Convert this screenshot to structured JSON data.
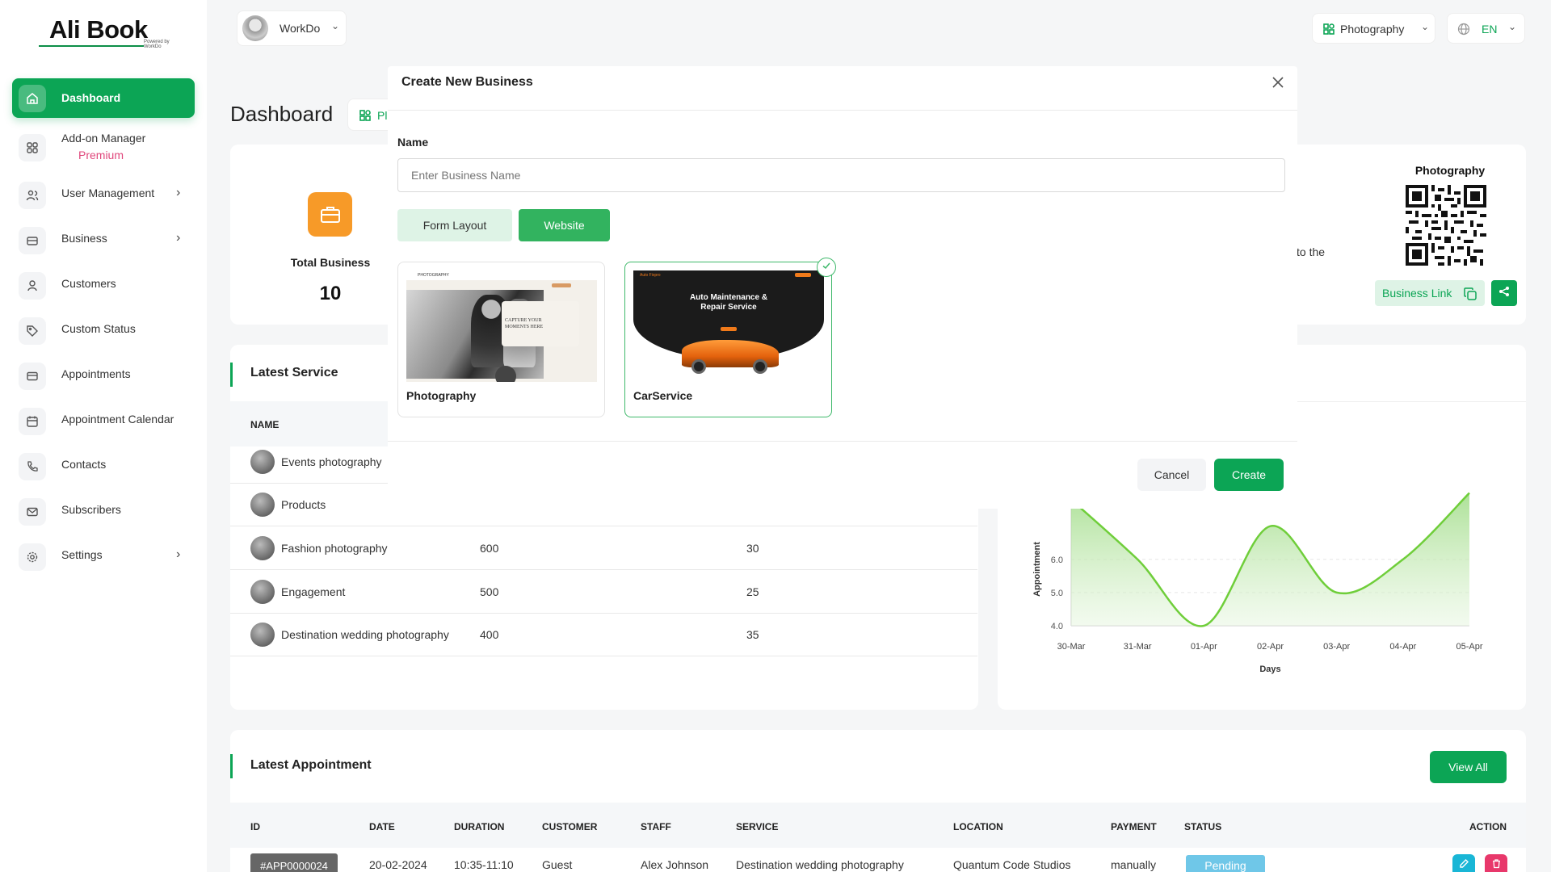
{
  "app": {
    "logo": "Ali Book",
    "logo_sub": "Powered by WorkDo"
  },
  "header": {
    "workspace": "WorkDo",
    "business_selector": "Photography",
    "language": "EN"
  },
  "sidebar": {
    "items": [
      {
        "label": "Dashboard",
        "sub": ""
      },
      {
        "label": "Add-on Manager",
        "sub": "Premium"
      },
      {
        "label": "User Management",
        "sub": ""
      },
      {
        "label": "Business",
        "sub": ""
      },
      {
        "label": "Customers",
        "sub": ""
      },
      {
        "label": "Custom Status",
        "sub": ""
      },
      {
        "label": "Appointments",
        "sub": ""
      },
      {
        "label": "Appointment Calendar",
        "sub": ""
      },
      {
        "label": "Contacts",
        "sub": ""
      },
      {
        "label": "Subscribers",
        "sub": ""
      },
      {
        "label": "Settings",
        "sub": ""
      }
    ]
  },
  "page": {
    "title": "Dashboard",
    "title_chip": "Pl"
  },
  "stats": {
    "total_business_label": "Total Business",
    "total_business_value": "10"
  },
  "business_card": {
    "title": "Photography",
    "partial_text": "to the",
    "link_label": "Business Link"
  },
  "latest_service": {
    "title": "Latest Service",
    "col_name": "NAME",
    "rows": [
      {
        "name": "Events photography",
        "price": "",
        "duration": ""
      },
      {
        "name": "Products",
        "price": "",
        "duration": ""
      },
      {
        "name": "Fashion photography",
        "price": "600",
        "duration": "30"
      },
      {
        "name": "Engagement",
        "price": "500",
        "duration": "25"
      },
      {
        "name": "Destination wedding photography",
        "price": "400",
        "duration": "35"
      }
    ]
  },
  "chart_data": {
    "type": "area",
    "x": [
      "30-Mar",
      "31-Mar",
      "01-Apr",
      "02-Apr",
      "03-Apr",
      "04-Apr",
      "05-Apr"
    ],
    "values": [
      7.8,
      6.0,
      4.0,
      7.0,
      5.0,
      6.0,
      8.0
    ],
    "xlabel": "Days",
    "ylabel": "Appointment",
    "yticks": [
      "4.0",
      "5.0",
      "6.0"
    ],
    "color": "#6fce3a"
  },
  "latest_appointment": {
    "title": "Latest Appointment",
    "view_all": "View All",
    "columns": [
      "ID",
      "DATE",
      "DURATION",
      "CUSTOMER",
      "STAFF",
      "SERVICE",
      "LOCATION",
      "PAYMENT",
      "STATUS",
      "ACTION"
    ],
    "rows": [
      {
        "id": "#APP0000024",
        "date": "20-02-2024",
        "duration": "10:35-11:10",
        "customer": "Guest",
        "staff": "Alex Johnson",
        "service": "Destination wedding photography",
        "location": "Quantum Code Studios",
        "payment": "manually",
        "status": "Pending"
      }
    ]
  },
  "modal": {
    "title": "Create New Business",
    "name_label": "Name",
    "name_placeholder": "Enter Business Name",
    "name_value": "",
    "tab_form": "Form Layout",
    "tab_website": "Website",
    "templates": [
      {
        "name": "Photography",
        "preview_brand": "PHOTOGRAPHY",
        "preview_headline": "CAPTURE YOUR MOMENTS HERE",
        "selected": false
      },
      {
        "name": "CarService",
        "preview_brand": "Auto Fixpro",
        "preview_headline": "Auto Maintenance & Repair Service",
        "selected": true
      }
    ],
    "cancel": "Cancel",
    "create": "Create"
  },
  "colors": {
    "primary": "#0ca555",
    "light_green": "#def3e6",
    "orange": "#f79a28",
    "pending": "#6fc7e8",
    "danger": "#e8386b",
    "accent_pink": "#e0477c"
  }
}
